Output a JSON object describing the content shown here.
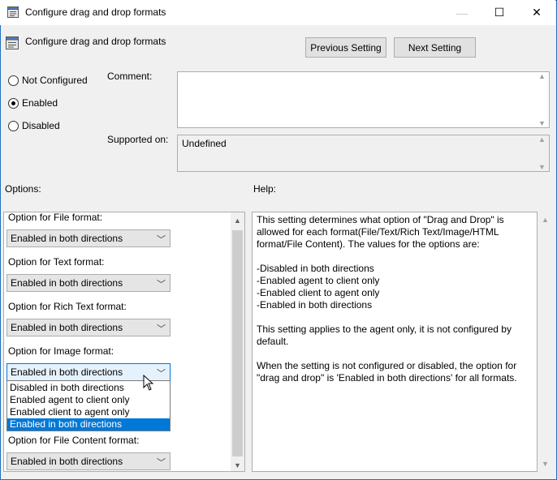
{
  "window": {
    "title": "Configure drag and drop formats",
    "minimize_glyph": "—",
    "maximize_glyph": "☐",
    "close_glyph": "✕"
  },
  "header": {
    "title": "Configure drag and drop formats"
  },
  "nav": {
    "previous_label": "Previous Setting",
    "next_label": "Next Setting"
  },
  "state": {
    "options": [
      {
        "label": "Not Configured",
        "checked": false
      },
      {
        "label": "Enabled",
        "checked": true
      },
      {
        "label": "Disabled",
        "checked": false
      }
    ]
  },
  "comment": {
    "label": "Comment:",
    "value": ""
  },
  "supported": {
    "label": "Supported on:",
    "value": "Undefined"
  },
  "options_panel": {
    "label": "Options:",
    "settings": [
      {
        "label": "Option for File format:",
        "value": "Enabled in both directions"
      },
      {
        "label": "Option for Text format:",
        "value": "Enabled in both directions"
      },
      {
        "label": "Option for Rich Text format:",
        "value": "Enabled in both directions"
      },
      {
        "label": "Option for Image format:",
        "value": "Enabled in both directions"
      },
      {
        "label": "Option for File Content format:",
        "value": "Enabled in both directions"
      }
    ],
    "open_dropdown": {
      "items": [
        "Disabled in both directions",
        "Enabled agent to client only",
        "Enabled client to agent only",
        "Enabled in both directions"
      ],
      "selected_index": 3
    }
  },
  "help": {
    "label": "Help:",
    "paragraphs": [
      "This setting determines what option of \"Drag and Drop\" is allowed for each format(File/Text/Rich Text/Image/HTML format/File Content). The values for the options are:",
      "-Disabled in both directions",
      "-Enabled agent to client only",
      "-Enabled client to agent only",
      "-Enabled in both directions",
      "This setting applies to the agent only, it is not configured by default.",
      "When the setting is not configured or disabled, the option for \"drag and drop\" is 'Enabled in both directions' for all formats."
    ]
  },
  "colors": {
    "accent": "#0078d7",
    "window_border": "#1f6fbf"
  },
  "icons": [
    "policy-icon",
    "chevron-down-icon",
    "scroll-up-icon",
    "scroll-down-icon",
    "mouse-pointer-icon"
  ]
}
